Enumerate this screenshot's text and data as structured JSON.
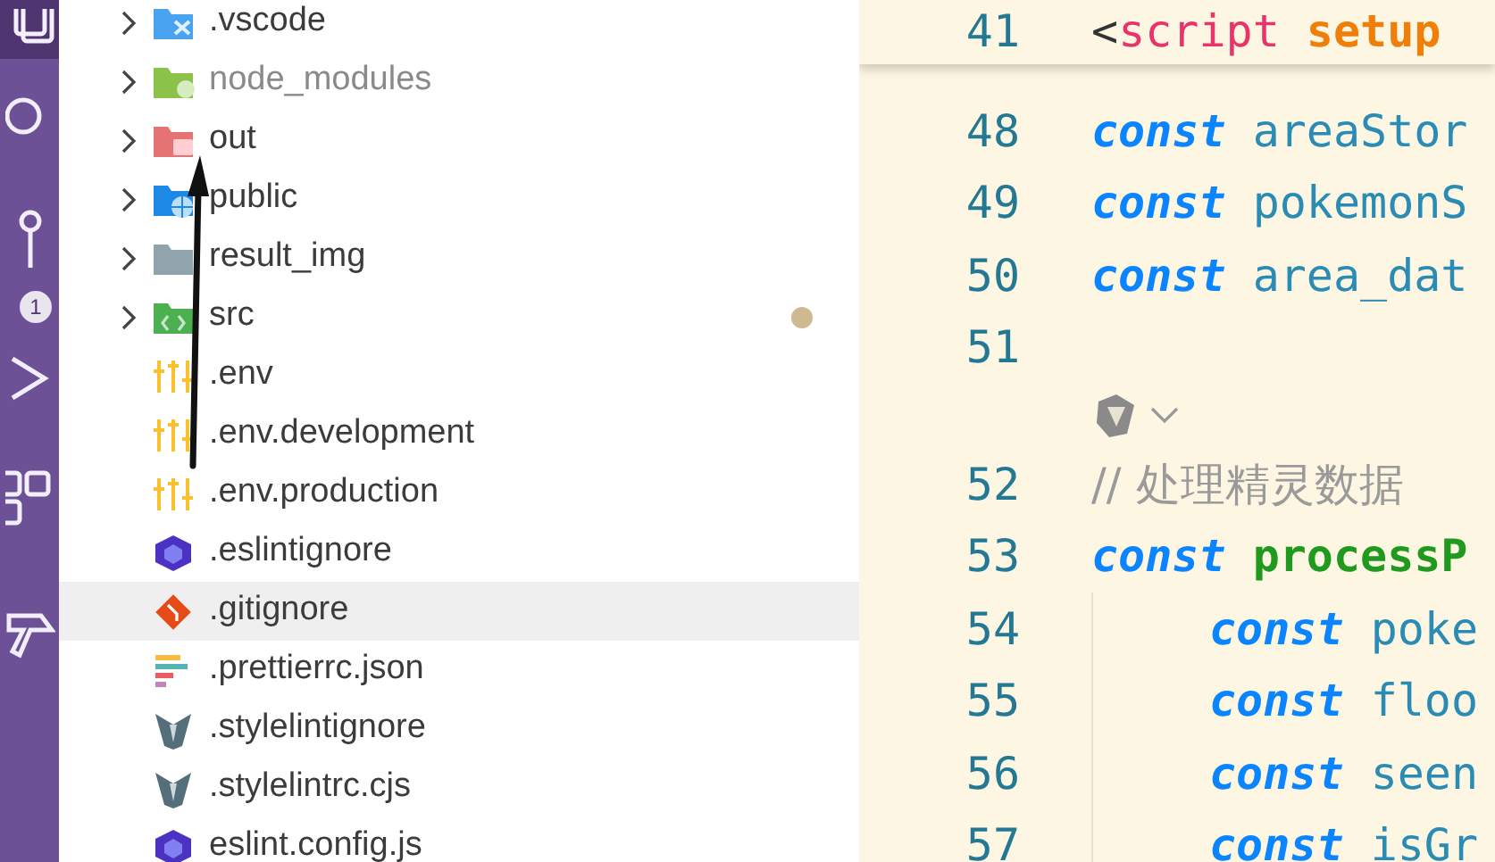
{
  "activity_bar": [
    {
      "kind": "explorer",
      "selected": true
    },
    {
      "kind": "search",
      "selected": false
    },
    {
      "kind": "scm",
      "selected": false,
      "badge": "1"
    },
    {
      "kind": "run",
      "selected": false
    },
    {
      "kind": "extensions",
      "selected": false
    },
    {
      "kind": "tool",
      "selected": false
    }
  ],
  "explorer": {
    "items": [
      {
        "name": ".vscode",
        "kind": "vscode",
        "expanded": false,
        "selected": false,
        "dimmed": false,
        "modified": false
      },
      {
        "name": "node_modules",
        "kind": "node",
        "expanded": false,
        "selected": false,
        "dimmed": true,
        "modified": false
      },
      {
        "name": "out",
        "kind": "out",
        "expanded": false,
        "selected": false,
        "dimmed": false,
        "modified": false
      },
      {
        "name": "public",
        "kind": "public",
        "expanded": false,
        "selected": false,
        "dimmed": false,
        "modified": false
      },
      {
        "name": "result_img",
        "kind": "folder",
        "expanded": false,
        "selected": false,
        "dimmed": false,
        "modified": false
      },
      {
        "name": "src",
        "kind": "source",
        "expanded": false,
        "selected": false,
        "dimmed": false,
        "modified": true
      },
      {
        "name": ".env",
        "kind": "env",
        "selected": false,
        "dimmed": false,
        "modified": false
      },
      {
        "name": ".env.development",
        "kind": "env",
        "selected": false,
        "dimmed": false,
        "modified": false
      },
      {
        "name": ".env.production",
        "kind": "env",
        "selected": false,
        "dimmed": false,
        "modified": false
      },
      {
        "name": ".eslintignore",
        "kind": "eslint",
        "selected": false,
        "dimmed": false,
        "modified": false
      },
      {
        "name": ".gitignore",
        "kind": "git",
        "selected": true,
        "dimmed": false,
        "modified": false
      },
      {
        "name": ".prettierrc.json",
        "kind": "prettier",
        "selected": false,
        "dimmed": false,
        "modified": false
      },
      {
        "name": ".stylelintignore",
        "kind": "stylelint",
        "selected": false,
        "dimmed": false,
        "modified": false
      },
      {
        "name": ".stylelintrc.cjs",
        "kind": "stylelint",
        "selected": false,
        "dimmed": false,
        "modified": false
      },
      {
        "name": "eslint.config.js",
        "kind": "eslint",
        "selected": false,
        "dimmed": false,
        "modified": false
      }
    ]
  },
  "editor": {
    "sticky_line": {
      "number": "41",
      "tokens": [
        {
          "text": "<",
          "kind": "punct"
        },
        {
          "text": "script",
          "kind": "tag"
        },
        {
          "text": " setup",
          "kind": "attr"
        }
      ]
    },
    "lines": [
      {
        "kind": "code",
        "number": "48",
        "tokens": [
          {
            "text": "const",
            "kind": "keyword"
          },
          {
            "text": " areaStor",
            "kind": "name"
          }
        ]
      },
      {
        "kind": "code",
        "number": "49",
        "tokens": [
          {
            "text": "const",
            "kind": "keyword"
          },
          {
            "text": " pokemonS",
            "kind": "name"
          }
        ]
      },
      {
        "kind": "code",
        "number": "50",
        "tokens": [
          {
            "text": "const",
            "kind": "keyword"
          },
          {
            "text": " area_dat",
            "kind": "name"
          }
        ]
      },
      {
        "kind": "code",
        "number": "51"
      },
      {
        "kind": "lens"
      },
      {
        "kind": "code",
        "number": "52",
        "tokens": [
          {
            "text": "// 处理精灵数据",
            "kind": "comment"
          }
        ]
      },
      {
        "kind": "code",
        "number": "53",
        "tokens": [
          {
            "text": "const",
            "kind": "keyword"
          },
          {
            "text": " processP",
            "kind": "function"
          }
        ],
        "children": [
          {
            "kind": "code",
            "number": "54",
            "tokens": [
              {
                "text": "const",
                "kind": "keyword"
              },
              {
                "text": " poke",
                "kind": "name"
              }
            ]
          },
          {
            "kind": "code",
            "number": "55",
            "tokens": [
              {
                "text": "const",
                "kind": "keyword"
              },
              {
                "text": " floo",
                "kind": "name"
              }
            ]
          },
          {
            "kind": "code",
            "number": "56",
            "tokens": [
              {
                "text": "const",
                "kind": "keyword"
              },
              {
                "text": " seen",
                "kind": "name"
              }
            ]
          },
          {
            "kind": "code",
            "number": "57",
            "tokens": [
              {
                "text": "const",
                "kind": "keyword"
              },
              {
                "text": " isGr",
                "kind": "name"
              }
            ]
          }
        ]
      }
    ]
  }
}
